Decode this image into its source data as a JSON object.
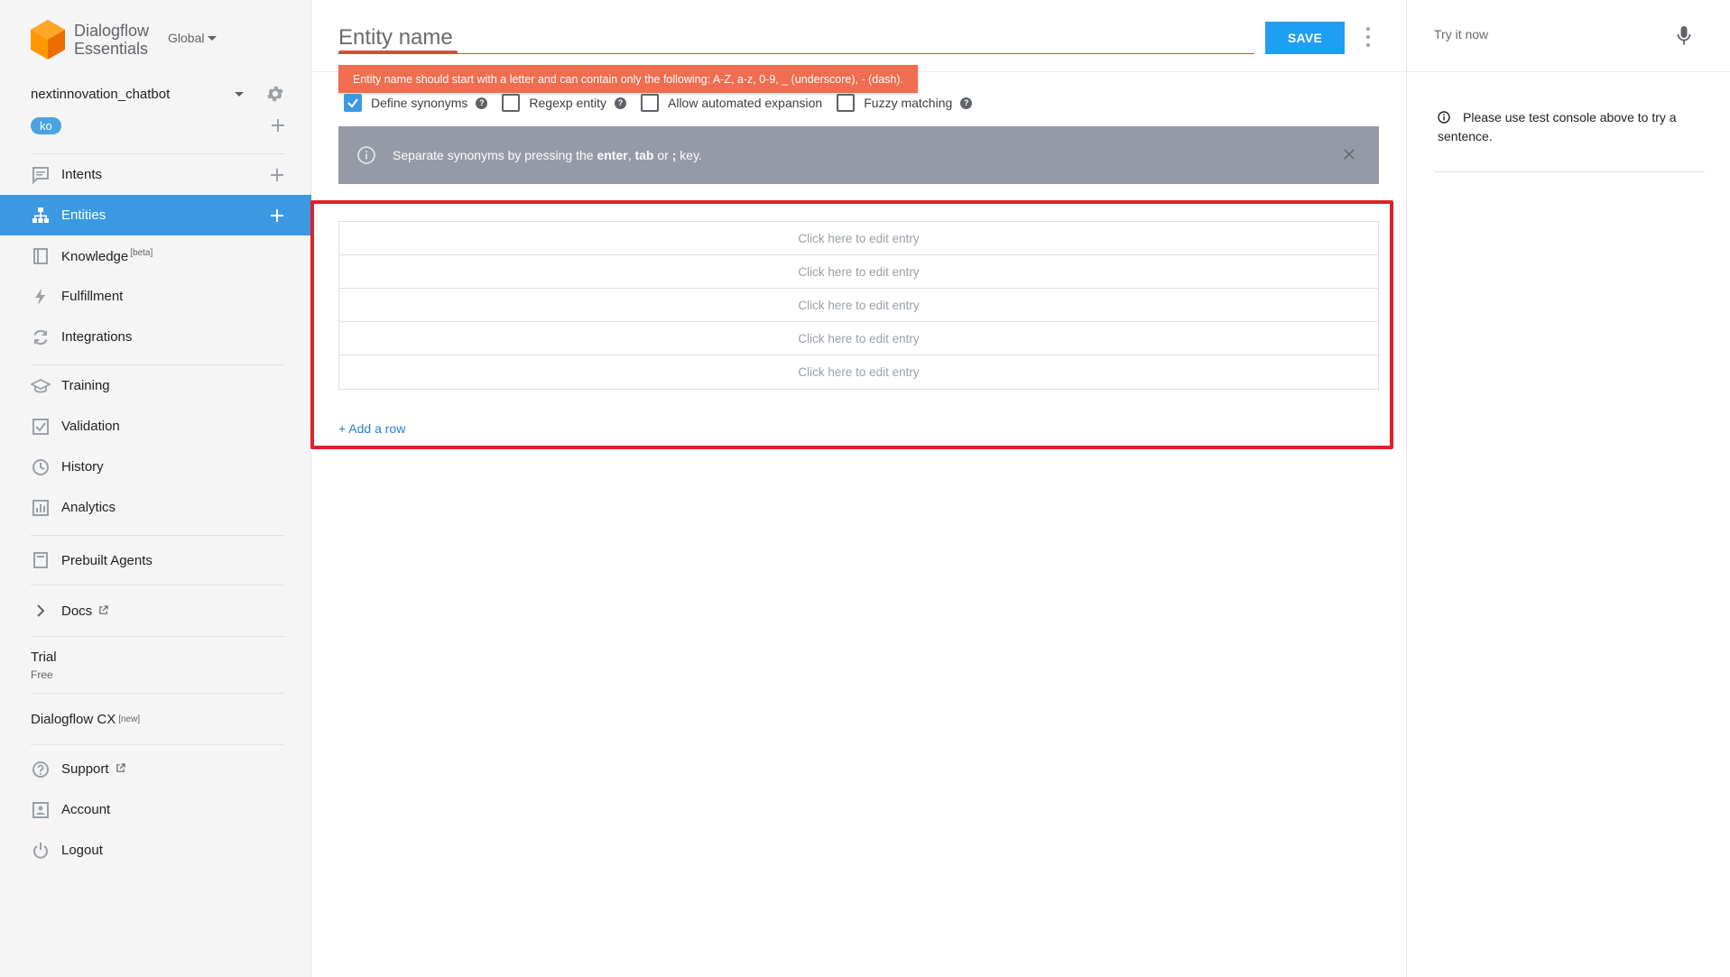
{
  "sidebar": {
    "brand_line1": "Dialogflow",
    "brand_line2": "Essentials",
    "region": "Global",
    "agent_name": "nextinnovation_chatbot",
    "language": "ko",
    "items": [
      {
        "label": "Intents"
      },
      {
        "label": "Entities"
      },
      {
        "label": "Knowledge",
        "badge": "[beta]"
      },
      {
        "label": "Fulfillment"
      },
      {
        "label": "Integrations"
      },
      {
        "label": "Training"
      },
      {
        "label": "Validation"
      },
      {
        "label": "History"
      },
      {
        "label": "Analytics"
      },
      {
        "label": "Prebuilt Agents"
      },
      {
        "label": "Docs"
      }
    ],
    "trial_title": "Trial",
    "trial_sub": "Free",
    "cx_label": "Dialogflow CX",
    "cx_badge": "[new]",
    "bottom": [
      {
        "label": "Support"
      },
      {
        "label": "Account"
      },
      {
        "label": "Logout"
      }
    ]
  },
  "main": {
    "entity_placeholder": "Entity name",
    "save_label": "SAVE",
    "error_message": "Entity name should start with a letter and can contain only the following: A-Z, a-z, 0-9, _ (underscore), - (dash).",
    "options": [
      {
        "label": "Define synonyms",
        "checked": true
      },
      {
        "label": "Regexp entity",
        "checked": false
      },
      {
        "label": "Allow automated expansion",
        "checked": false
      },
      {
        "label": "Fuzzy matching",
        "checked": false
      }
    ],
    "banner": {
      "prefix": "Separate synonyms by pressing the ",
      "k1": "enter",
      "sep1": ", ",
      "k2": "tab",
      "sep2": " or ",
      "k3": ";",
      "suffix": " key."
    },
    "entries": [
      "Click here to edit entry",
      "Click here to edit entry",
      "Click here to edit entry",
      "Click here to edit entry",
      "Click here to edit entry"
    ],
    "add_row": "+ Add a row"
  },
  "right": {
    "try_placeholder": "Try it now",
    "hint": "Please use test console above to try a sentence."
  },
  "colors": {
    "accent": "#3b99e2",
    "save": "#1e9ff2",
    "error": "#f06d4f",
    "highlight": "#e0202b",
    "banner": "#959aa6"
  }
}
